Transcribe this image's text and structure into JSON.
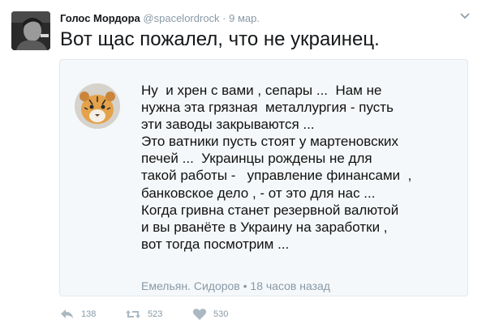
{
  "tweet": {
    "author_name": "Голос Мордора",
    "handle": "@spacelordrock",
    "separator": "·",
    "date": "9 мар.",
    "text": "Вот щас пожалел, что не украинец."
  },
  "quoted_post": {
    "text": "Ну  и хрен с вами , сепары ...  Нам не\nнужна эта грязная  металлургия - пусть\nэти заводы закрываются ...\nЭто ватники пусть стоят у мартеновских\nпечей ...  Украинцы рождены не для\nтакой работы -   управление финансами  ,\nбанковское дело , - от это для нас ...\nКогда гривна станет резервной валютой\nи вы рванёте в Украину на заработки ,\nвот тогда посмотрим ...",
    "author": "Емельян. Сидоров",
    "separator": "•",
    "time": "18 часов назад"
  },
  "actions": {
    "reply_count": "138",
    "retweet_count": "523",
    "like_count": "530"
  },
  "colors": {
    "muted": "#8899a6",
    "icon": "#aab8c2",
    "card_bg": "#f5f8fa",
    "card_border": "#e1e8ed"
  }
}
